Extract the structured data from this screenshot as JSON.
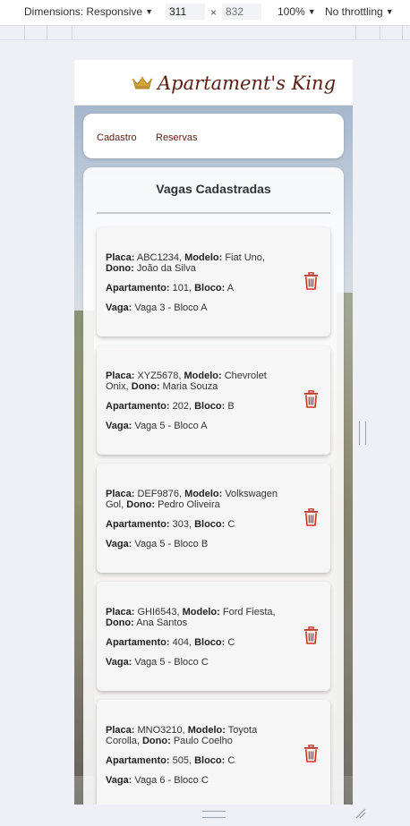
{
  "devtools": {
    "dimensions_label": "Dimensions: Responsive",
    "width_value": "311",
    "height_value": "832",
    "times": "×",
    "zoom": "100%",
    "throttling": "No throttling"
  },
  "header": {
    "brand": "Apartament's King",
    "logo_icon": "crown-icon"
  },
  "nav": {
    "items": [
      {
        "label": "Cadastro"
      },
      {
        "label": "Reservas"
      }
    ]
  },
  "main": {
    "title": "Vagas Cadastradas",
    "labels": {
      "placa": "Placa:",
      "modelo": "Modelo:",
      "dono": "Dono:",
      "apartamento": "Apartamento:",
      "bloco": "Bloco:",
      "vaga": "Vaga:"
    },
    "vagas": [
      {
        "placa": "ABC1234",
        "modelo": "Fiat Uno",
        "dono": "João da Silva",
        "apartamento": "101",
        "bloco": "A",
        "vaga": "Vaga 3 - Bloco A"
      },
      {
        "placa": "XYZ5678",
        "modelo": "Chevrolet Onix",
        "dono": "Maria Souza",
        "apartamento": "202",
        "bloco": "B",
        "vaga": "Vaga 5 - Bloco A"
      },
      {
        "placa": "DEF9876",
        "modelo": "Volkswagen Gol",
        "dono": "Pedro Oliveira",
        "apartamento": "303",
        "bloco": "C",
        "vaga": "Vaga 5 - Bloco B"
      },
      {
        "placa": "GHI6543",
        "modelo": "Ford Fiesta",
        "dono": "Ana Santos",
        "apartamento": "404",
        "bloco": "C",
        "vaga": "Vaga 5 - Bloco C"
      },
      {
        "placa": "MNO3210",
        "modelo": "Toyota Corolla",
        "dono": "Paulo Coelho",
        "apartamento": "505",
        "bloco": "C",
        "vaga": "Vaga 6 - Bloco C"
      }
    ]
  },
  "colors": {
    "brand": "#5a1f12",
    "delete": "#c0392b",
    "crown": "#d4a437"
  }
}
